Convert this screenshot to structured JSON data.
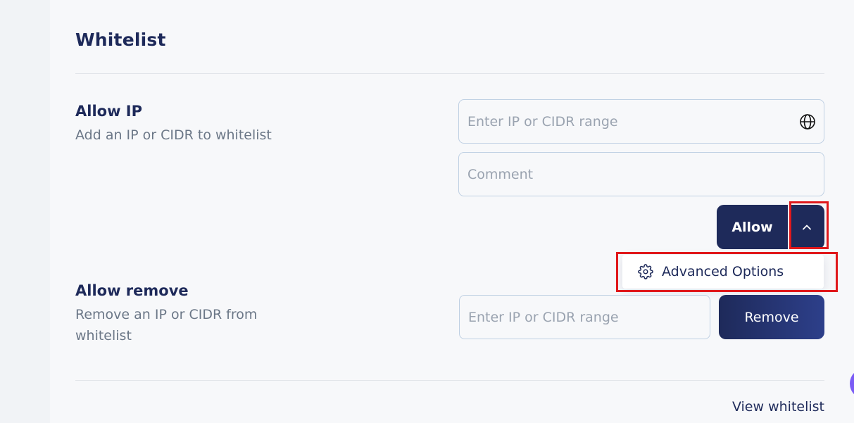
{
  "whitelist": {
    "title": "Whitelist",
    "allow_ip": {
      "title": "Allow IP",
      "description": "Add an IP or CIDR to whitelist",
      "ip_placeholder": "Enter IP or CIDR range",
      "comment_placeholder": "Comment",
      "allow_label": "Allow",
      "ip_icon": "globe-icon",
      "toggle_icon": "chevron-up-icon"
    },
    "dropdown": {
      "icon": "gear-icon",
      "label": "Advanced Options"
    },
    "allow_remove": {
      "title": "Allow remove",
      "description": "Remove an IP or CIDR from whitelist",
      "ip_placeholder": "Enter IP or CIDR range",
      "remove_label": "Remove"
    },
    "view_link": "View whitelist"
  },
  "colors": {
    "primary": "#1e2a5a",
    "highlight": "#e0181b",
    "chat_bubble": "#7b5cf5"
  }
}
